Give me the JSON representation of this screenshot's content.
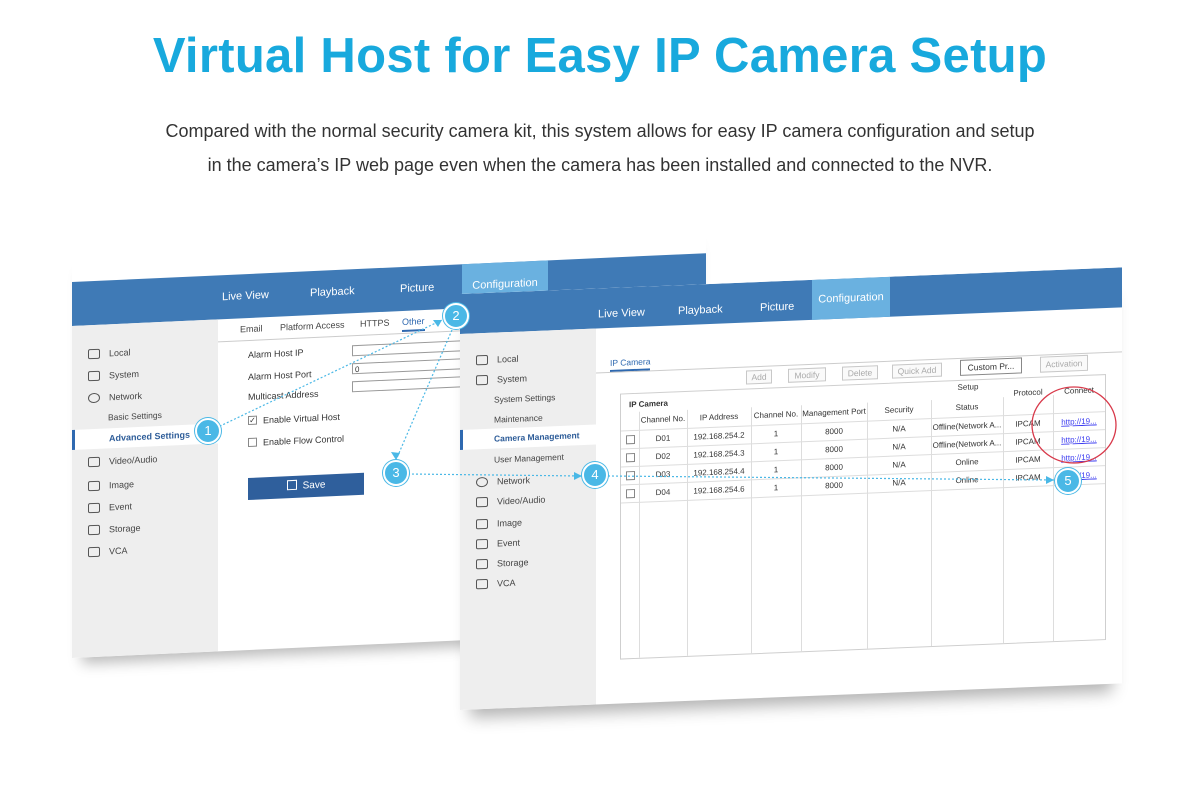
{
  "headline": "Virtual Host for Easy IP Camera Setup",
  "description": {
    "line1": "Compared with the normal security camera kit, this system allows for easy IP camera configuration and setup",
    "line2": "in the camera’s IP web page even when the camera has been installed and connected to the NVR."
  },
  "colors": {
    "headline": "#18a9dd",
    "topbar": "#3f7ab6",
    "active_tab": "#6ab1e0",
    "marker": "#4ab8e6",
    "highlight_circle": "#d8394a"
  },
  "window1": {
    "nav": {
      "live_view": "Live View",
      "playback": "Playback",
      "picture": "Picture",
      "configuration": "Configuration"
    },
    "tabs": {
      "email": "Email",
      "platform_access": "Platform Access",
      "https": "HTTPS",
      "other": "Other"
    },
    "sidebar": {
      "local": "Local",
      "system": "System",
      "network": "Network",
      "basic_settings": "Basic Settings",
      "advanced_settings": "Advanced Settings",
      "video_audio": "Video/Audio",
      "image": "Image",
      "event": "Event",
      "storage": "Storage",
      "vca": "VCA"
    },
    "form": {
      "alarm_host_ip_label": "Alarm Host IP",
      "alarm_host_ip_value": "",
      "alarm_host_port_label": "Alarm Host Port",
      "alarm_host_port_value": "0",
      "multicast_label": "Multicast Address",
      "multicast_value": "",
      "enable_virtual_host": "Enable Virtual Host",
      "enable_virtual_host_checked": "✓",
      "enable_flow_control": "Enable Flow Control",
      "save": "Save"
    }
  },
  "window2": {
    "nav": {
      "live_view": "Live View",
      "playback": "Playback",
      "picture": "Picture",
      "configuration": "Configuration"
    },
    "tab": "IP Camera",
    "sidebar": {
      "local": "Local",
      "system": "System",
      "system_settings": "System Settings",
      "maintenance": "Maintenance",
      "camera_management": "Camera Management",
      "user_management": "User Management",
      "network": "Network",
      "video_audio": "Video/Audio",
      "image": "Image",
      "event": "Event",
      "storage": "Storage",
      "vca": "VCA"
    },
    "toolbar": {
      "add": "Add",
      "modify": "Modify",
      "delete": "Delete",
      "quick_add": "Quick Add",
      "custom_protocol": "Custom Pr...",
      "activation": "Activation"
    },
    "table": {
      "title": "IP Camera",
      "headers": [
        "Channel No.",
        "IP Address",
        "Channel No.",
        "Management Port",
        "Security",
        "Status",
        "Protocol",
        "Connect"
      ],
      "setup_label": "Setup",
      "rows": [
        [
          "D01",
          "192.168.254.2",
          "1",
          "8000",
          "N/A",
          "Offline(Network A...",
          "IPCAM",
          "http://19..."
        ],
        [
          "D02",
          "192.168.254.3",
          "1",
          "8000",
          "N/A",
          "Offline(Network A...",
          "IPCAM",
          "http://19..."
        ],
        [
          "D03",
          "192.168.254.4",
          "1",
          "8000",
          "N/A",
          "Online",
          "IPCAM",
          "http://19..."
        ],
        [
          "D04",
          "192.168.254.6",
          "1",
          "8000",
          "N/A",
          "Online",
          "IPCAM",
          "http://19..."
        ]
      ]
    }
  },
  "markers": [
    "1",
    "2",
    "3",
    "4",
    "5"
  ]
}
